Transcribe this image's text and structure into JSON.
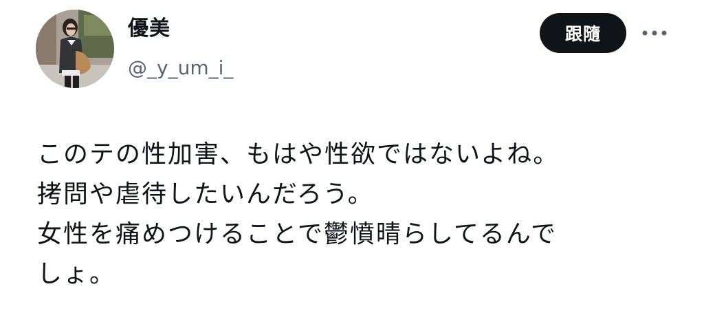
{
  "user": {
    "display_name": "優美",
    "handle": "@_y_um_i_"
  },
  "actions": {
    "follow_label": "跟隨",
    "more_icon": "more-horizontal-icon"
  },
  "tweet": {
    "lines": [
      "このテの性加害、もはや性欲ではないよね。",
      "拷問や虐待したいんだろう。",
      "女性を痛めつけることで鬱憤晴らしてるんで",
      "しょ。"
    ]
  },
  "colors": {
    "text": "#0f1419",
    "secondary": "#536471",
    "follow_bg": "#0f1419",
    "follow_text": "#ffffff"
  }
}
